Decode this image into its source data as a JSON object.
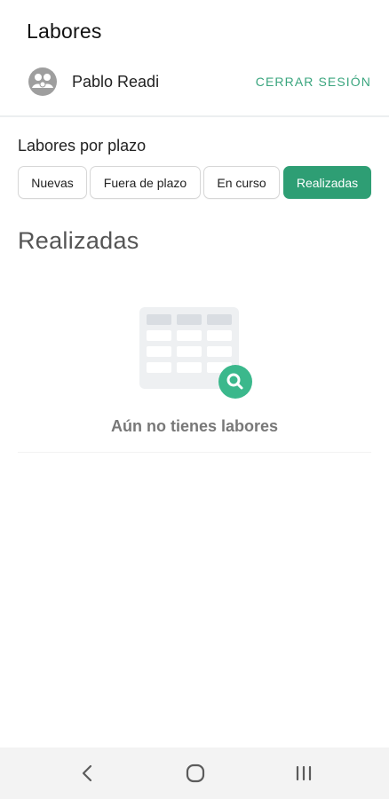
{
  "header": {
    "title": "Labores",
    "user_name": "Pablo Readi",
    "logout_label": "CERRAR SESIÓN"
  },
  "filters": {
    "label": "Labores por plazo",
    "options": [
      {
        "label": "Nuevas",
        "active": false
      },
      {
        "label": "Fuera de plazo",
        "active": false
      },
      {
        "label": "En curso",
        "active": false
      },
      {
        "label": "Realizadas",
        "active": true
      }
    ]
  },
  "content": {
    "title": "Realizadas",
    "empty_message": "Aún no tienes labores"
  },
  "icons": {
    "avatar": "user-group-avatar-icon",
    "empty": "empty-table-search-icon",
    "nav_back": "chevron-left-icon",
    "nav_home": "home-circle-icon",
    "nav_recent": "recent-apps-icon"
  },
  "colors": {
    "accent": "#2e9e74",
    "accent_text": "#3aa57e",
    "navbar_bg": "#f3f3f3"
  }
}
